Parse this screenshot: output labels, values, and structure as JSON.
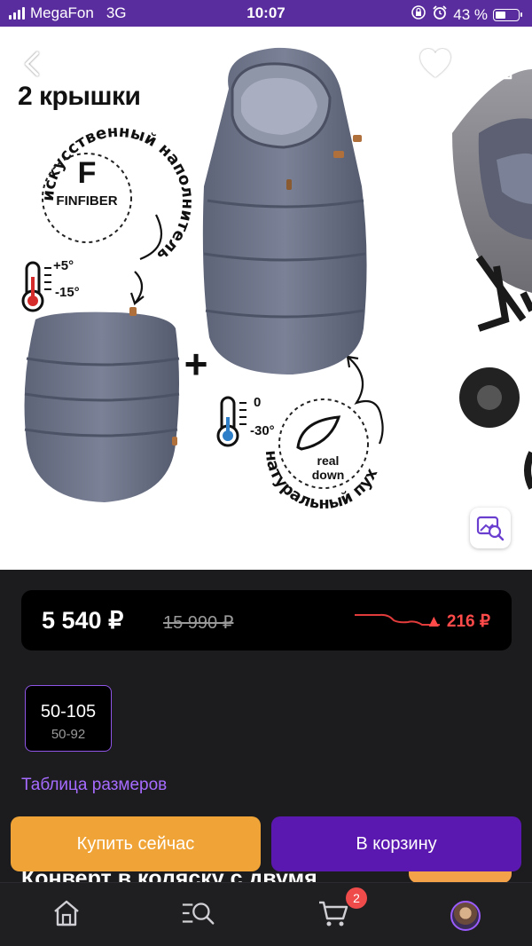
{
  "status_bar": {
    "carrier": "MegaFon",
    "network": "3G",
    "time": "10:07",
    "battery": "43 %"
  },
  "gallery": {
    "title": "2 крышки",
    "filler_ring_text": "искусственный наполнитель",
    "filler_brand": "FINFIBER",
    "filler_mark": "F",
    "warm_range_top": "+5°",
    "warm_range_bottom": "-15°",
    "cold_range_top": "0",
    "cold_range_bottom": "-30°",
    "plus_sign": "+",
    "down_ring_text": "натуральный пух",
    "down_label_1": "real",
    "down_label_2": "down"
  },
  "price": {
    "current": "5 540 ₽",
    "old": "15 990 ₽",
    "drop": "▲ 216 ₽",
    "trend_color": "#e23b3b"
  },
  "size": {
    "selected": "50-105",
    "sub": "50-92"
  },
  "size_table_link": "Таблица размеров",
  "product_title": "Конверт в коляску с двумя",
  "buttons": {
    "buy_now": "Купить сейчас",
    "add_to_cart": "В корзину"
  },
  "nav": {
    "cart_count": "2"
  },
  "colors": {
    "accent": "#5b18b0",
    "buy": "#f0a437",
    "link": "#a66bff",
    "drop": "#ff4a4a"
  }
}
